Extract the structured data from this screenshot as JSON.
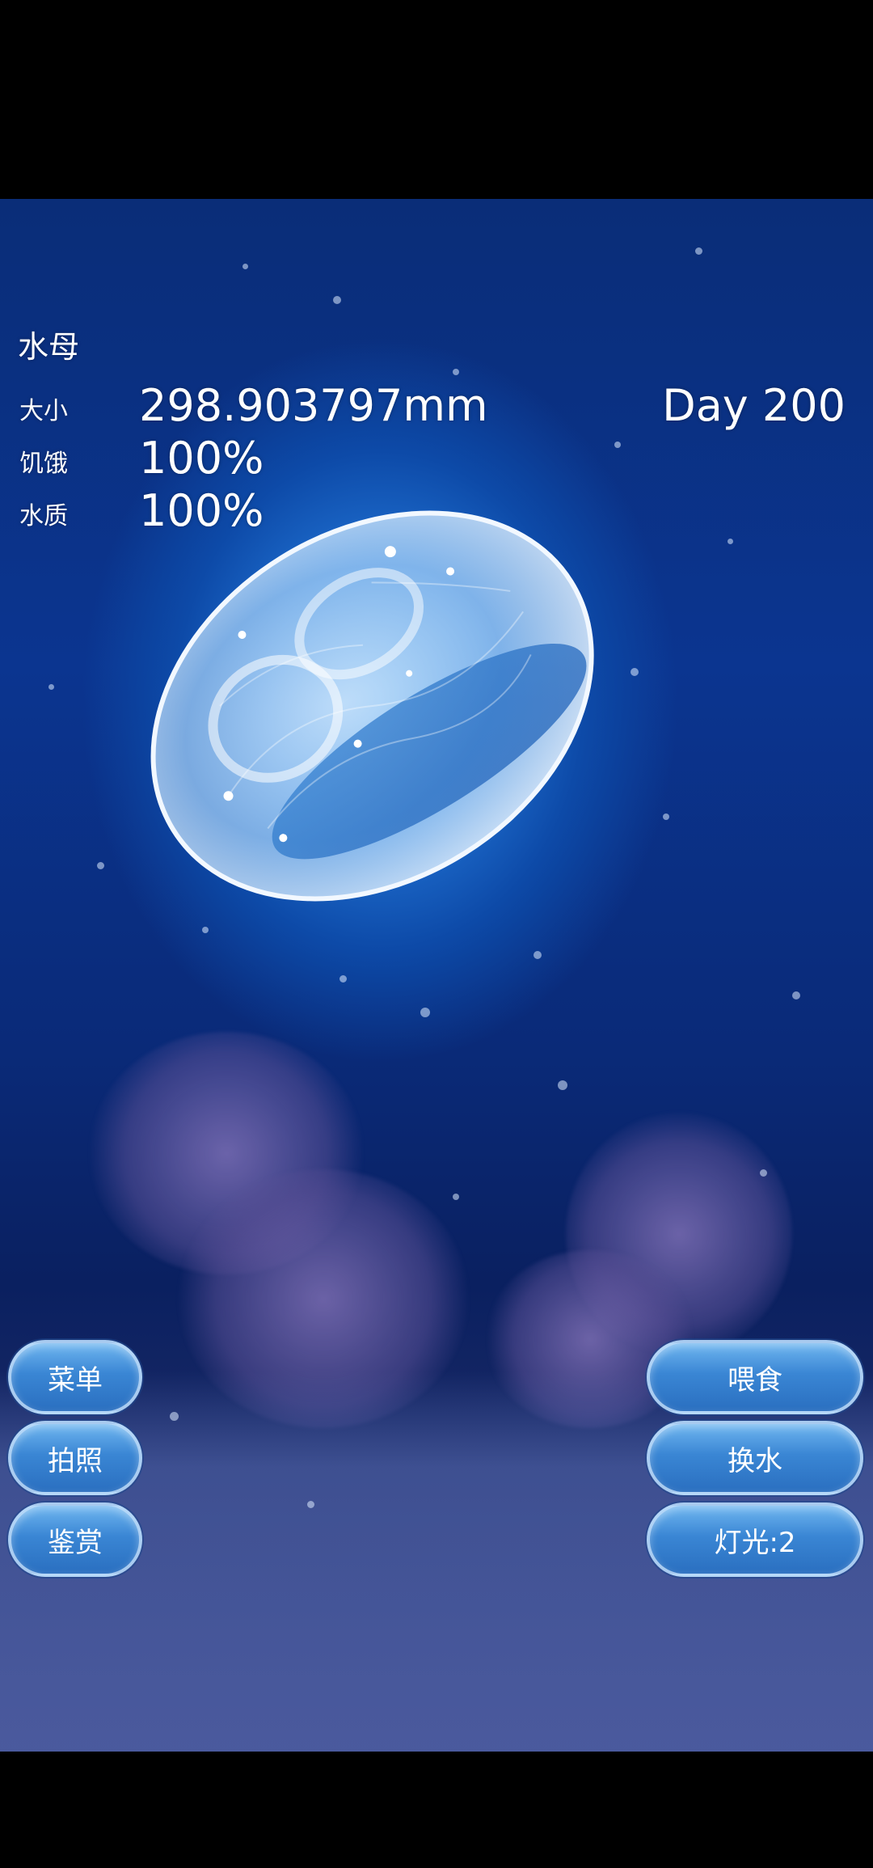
{
  "hud": {
    "creature_name": "水母",
    "stats": {
      "size_label": "大小",
      "size_value": "298.903797mm",
      "hunger_label": "饥饿",
      "hunger_value": "100%",
      "water_label": "水质",
      "water_value": "100%"
    },
    "day": "Day 200"
  },
  "buttons": {
    "menu": "菜单",
    "photo": "拍照",
    "appreciate": "鉴赏",
    "feed": "喂食",
    "change_water": "换水",
    "light": "灯光:2"
  },
  "colors": {
    "water_deep": "#0a2d78",
    "water_glow": "#3d8fe0",
    "button_blue": "#3a86d4",
    "text": "#ffffff"
  }
}
